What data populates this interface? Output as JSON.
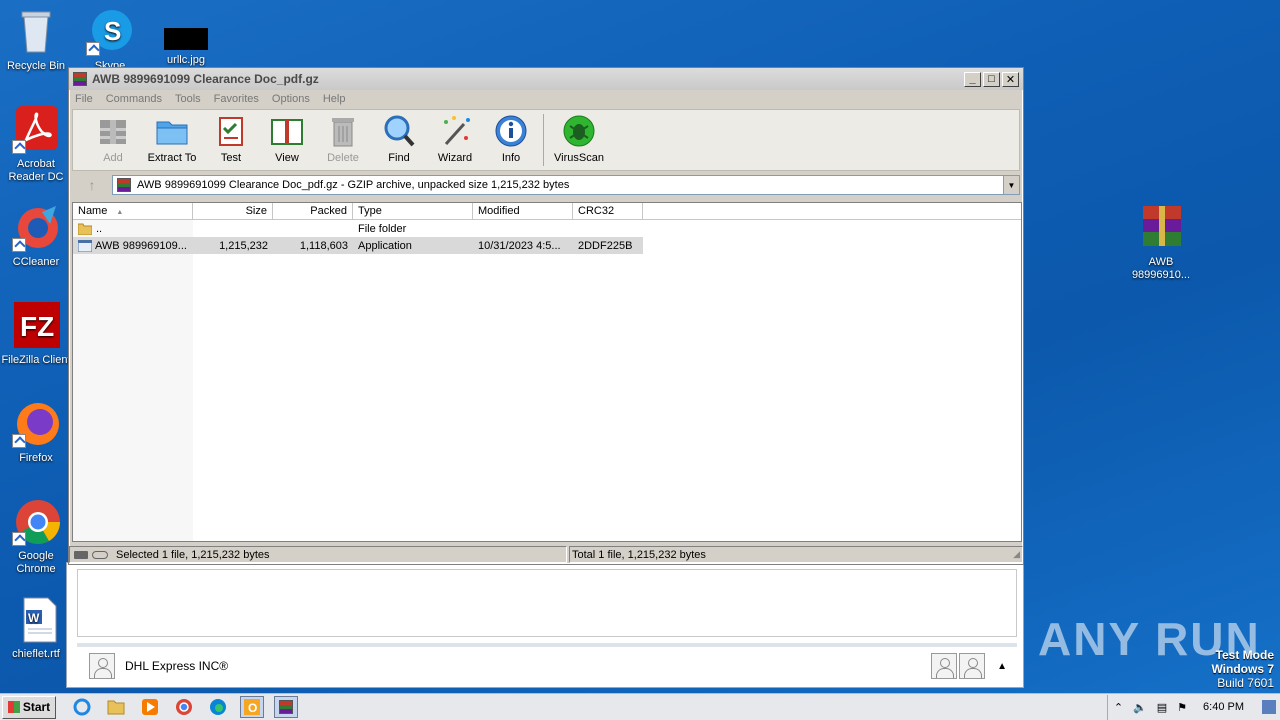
{
  "desktop": {
    "icons": [
      {
        "label": "Recycle Bin"
      },
      {
        "label": "Skype"
      },
      {
        "label": "urllc.jpg"
      },
      {
        "label": "Acrobat Reader DC"
      },
      {
        "label": "CCleaner"
      },
      {
        "label": "FileZilla Client"
      },
      {
        "label": "Firefox"
      },
      {
        "label": "Google Chrome"
      },
      {
        "label": "chieflet.rtf"
      },
      {
        "label": "AWB 98996910..."
      }
    ]
  },
  "window": {
    "title": "AWB 9899691099 Clearance Doc_pdf.gz",
    "menu": [
      "File",
      "Commands",
      "Tools",
      "Favorites",
      "Options",
      "Help"
    ],
    "toolbar": [
      "Add",
      "Extract To",
      "Test",
      "View",
      "Delete",
      "Find",
      "Wizard",
      "Info",
      "VirusScan"
    ],
    "address": "AWB 9899691099 Clearance Doc_pdf.gz - GZIP archive, unpacked size 1,215,232 bytes",
    "columns": [
      "Name",
      "Size",
      "Packed",
      "Type",
      "Modified",
      "CRC32"
    ],
    "rows": [
      {
        "name": "..",
        "size": "",
        "packed": "",
        "type": "File folder",
        "modified": "",
        "crc": ""
      },
      {
        "name": "AWB 989969109...",
        "size": "1,215,232",
        "packed": "1,118,603",
        "type": "Application",
        "modified": "10/31/2023 4:5...",
        "crc": "2DDF225B"
      }
    ],
    "status_left": "Selected 1 file, 1,215,232 bytes",
    "status_right": "Total 1 file, 1,215,232 bytes"
  },
  "mail": {
    "sender": "DHL Express INC®"
  },
  "watermark": "ANY RUN",
  "testmode": {
    "line1": "Test Mode",
    "line2": "Windows 7",
    "line3": "Build 7601"
  },
  "taskbar": {
    "start": "Start",
    "clock": "6:40 PM"
  }
}
